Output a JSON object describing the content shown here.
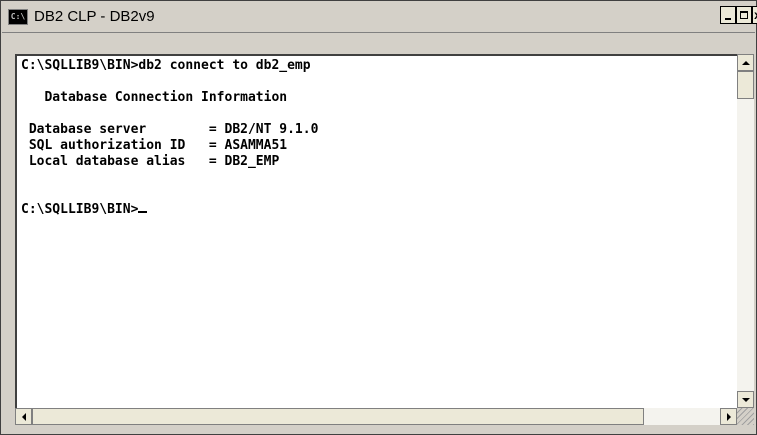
{
  "window": {
    "title": "DB2 CLP - DB2v9",
    "icon": "console-icon",
    "icon_text": "C:\\",
    "controls": {
      "minimize": "minimize-icon",
      "maximize": "maximize-icon",
      "close_glyph": "x"
    }
  },
  "console": {
    "lines": [
      "C:\\SQLLIB9\\BIN>db2 connect to db2_emp",
      "",
      "   Database Connection Information",
      "",
      " Database server        = DB2/NT 9.1.0",
      " SQL authorization ID   = ASAMMA51",
      " Local database alias   = DB2_EMP",
      "",
      ""
    ],
    "prompt": "C:\\SQLLIB9\\BIN>"
  },
  "colors": {
    "chrome": "#d4d0c8",
    "console_bg": "#ffffff",
    "console_text": "#000000"
  }
}
